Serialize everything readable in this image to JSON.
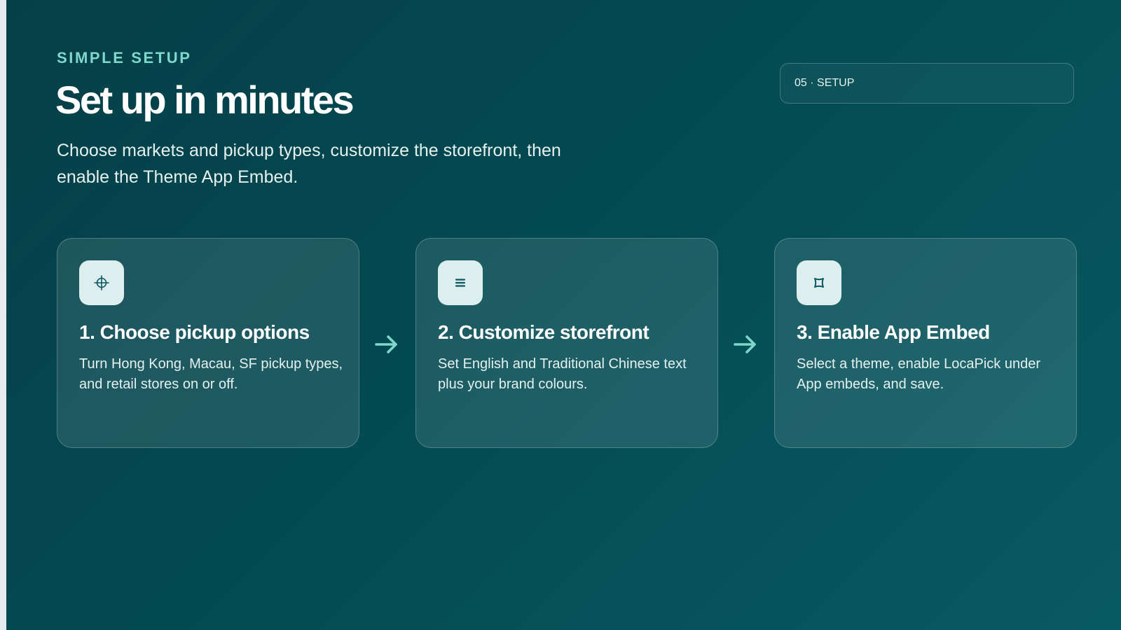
{
  "header": {
    "eyebrow": "SIMPLE SETUP",
    "title": "Set up in minutes",
    "subtitle": "Choose markets and pickup types, customize the storefront, then enable the Theme App Embed."
  },
  "badge": {
    "label": "05 · SETUP"
  },
  "steps": [
    {
      "icon": "crosshair-icon",
      "title": "1. Choose pickup options",
      "description": "Turn Hong Kong, Macau, SF pickup types, and retail stores on or off."
    },
    {
      "icon": "menu-lines-icon",
      "title": "2. Customize storefront",
      "description": "Set English and Traditional Chinese text plus your brand colours."
    },
    {
      "icon": "embed-frame-icon",
      "title": "3. Enable App Embed",
      "description": "Select a theme, enable LocaPick under App embeds, and save."
    }
  ],
  "colors": {
    "accent": "#7fd8cc",
    "background_start": "#063f48",
    "background_end": "#085a62",
    "icon_tile": "#dcefee",
    "icon_stroke": "#0b5560"
  }
}
